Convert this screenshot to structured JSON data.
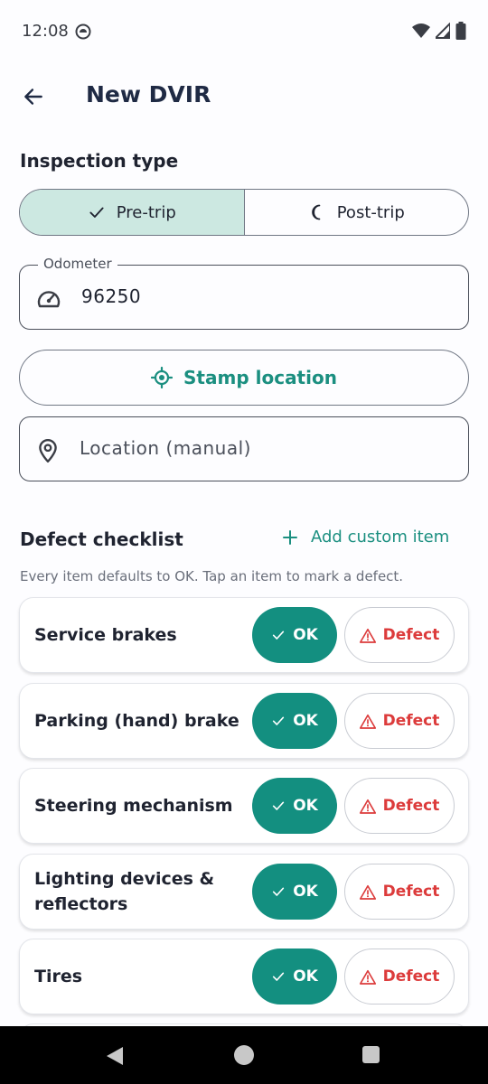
{
  "status_bar": {
    "time": "12:08"
  },
  "app_bar": {
    "title": "New DVIR"
  },
  "inspection": {
    "heading": "Inspection type",
    "options": [
      {
        "label": "Pre-trip",
        "selected": true
      },
      {
        "label": "Post-trip",
        "selected": false
      }
    ]
  },
  "odometer": {
    "label": "Odometer",
    "value": "96250"
  },
  "stamp_location": {
    "label": "Stamp location"
  },
  "location_manual": {
    "placeholder": "Location (manual)"
  },
  "checklist": {
    "heading": "Defect checklist",
    "add_custom_label": "Add custom item",
    "hint": "Every item defaults to OK. Tap an item to mark a defect.",
    "ok_label": "OK",
    "defect_label": "Defect",
    "items": [
      {
        "label": "Service brakes",
        "status": "OK"
      },
      {
        "label": "Parking (hand) brake",
        "status": "OK"
      },
      {
        "label": "Steering mechanism",
        "status": "OK"
      },
      {
        "label": "Lighting devices & reflectors",
        "status": "OK"
      },
      {
        "label": "Tires",
        "status": "OK"
      }
    ]
  },
  "colors": {
    "accent": "#138f80",
    "selected_segment": "#cce8e1",
    "defect": "#dc3b3b"
  }
}
